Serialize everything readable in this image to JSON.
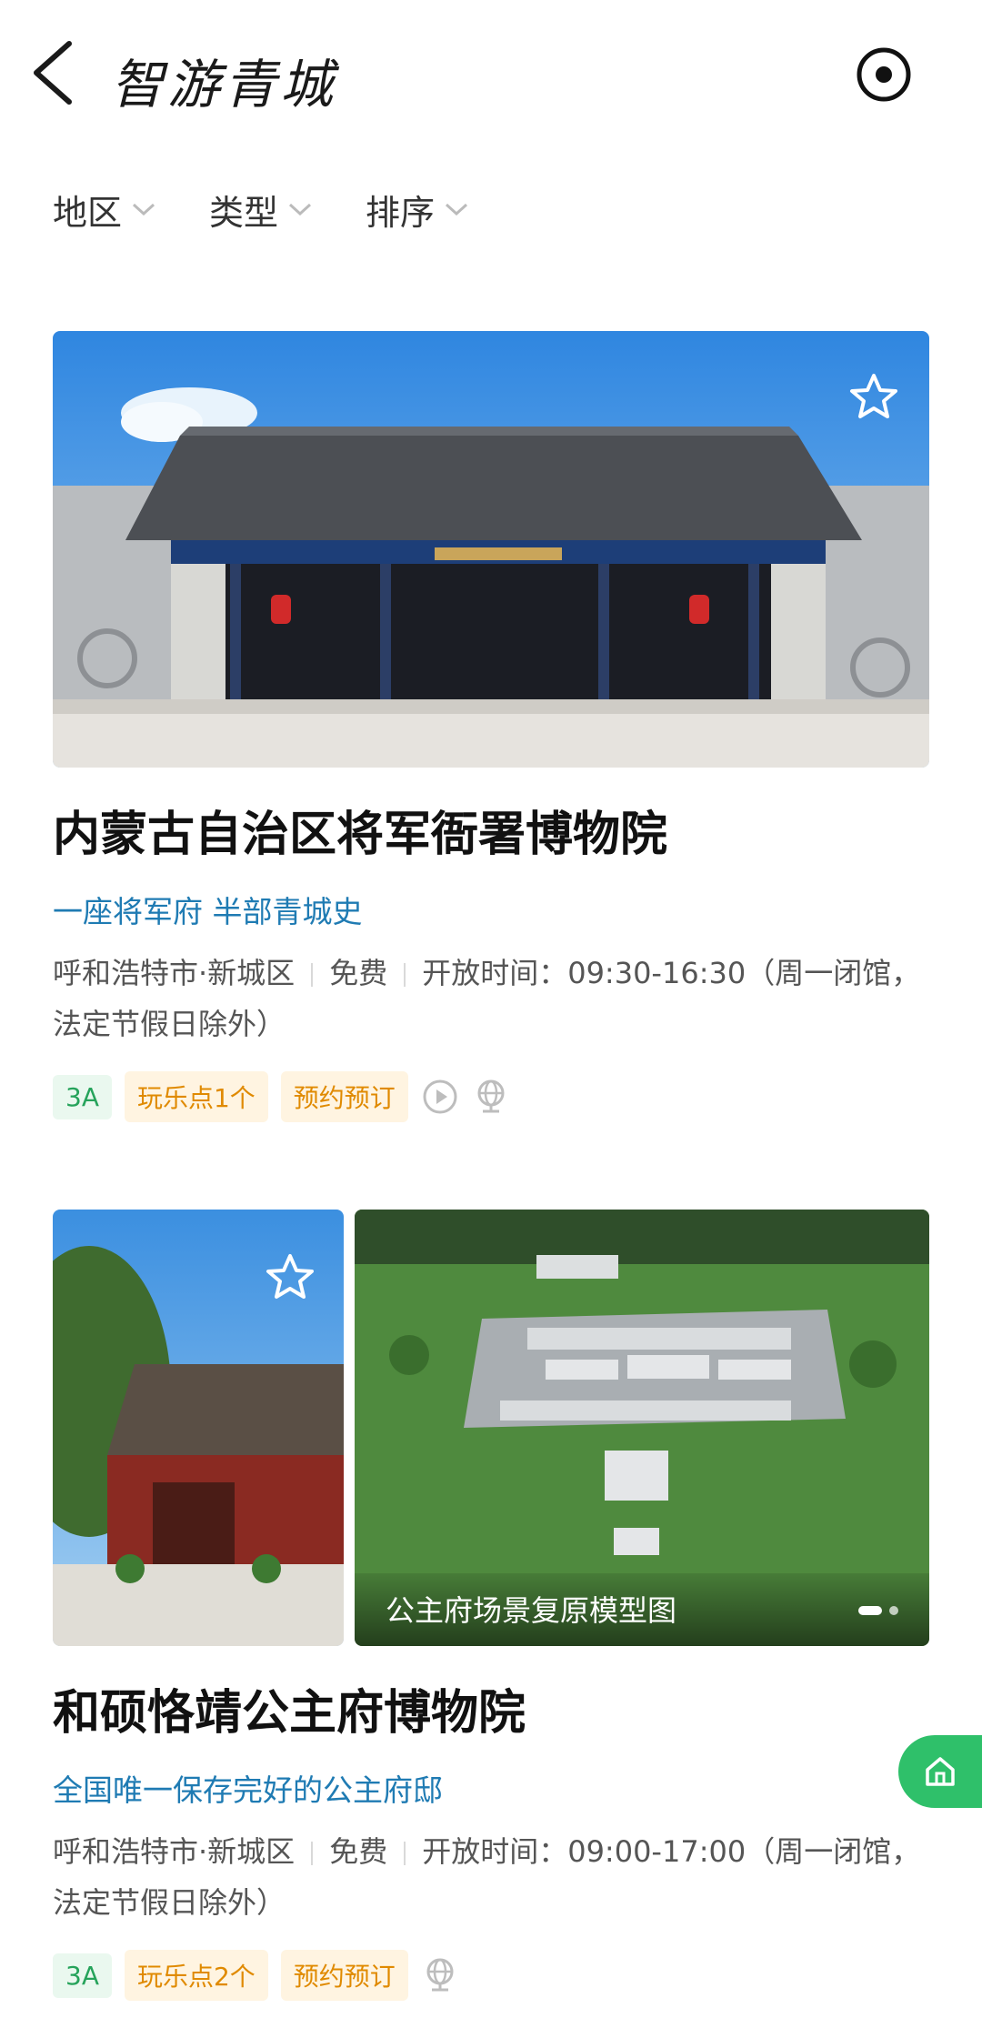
{
  "header": {
    "title": "智游青城"
  },
  "filters": [
    {
      "label": "地区"
    },
    {
      "label": "类型"
    },
    {
      "label": "排序"
    }
  ],
  "cards": [
    {
      "name": "内蒙古自治区将军衙署博物院",
      "slogan": "一座将军府 半部青城史",
      "location": "呼和浩特市·新城区",
      "price": "免费",
      "hours": "开放时间：09:30-16:30（周一闭馆，法定节假日除外）",
      "level": "3A",
      "tag_spots": "玩乐点1个",
      "tag_booking": "预约预订"
    },
    {
      "name": "和硕恪靖公主府博物院",
      "slogan": "全国唯一保存完好的公主府邸",
      "location": "呼和浩特市·新城区",
      "price": "免费",
      "hours": "开放时间：09:00-17:00（周一闭馆，法定节假日除外）",
      "level": "3A",
      "tag_spots": "玩乐点2个",
      "tag_booking": "预约预订",
      "gallery_caption": "公主府场景复原模型图"
    }
  ],
  "colors": {
    "slogan": "#1f7bb3",
    "level_tag": "#26a35b",
    "orange_tag": "#e08a00",
    "accent_green": "#2fc06a"
  }
}
